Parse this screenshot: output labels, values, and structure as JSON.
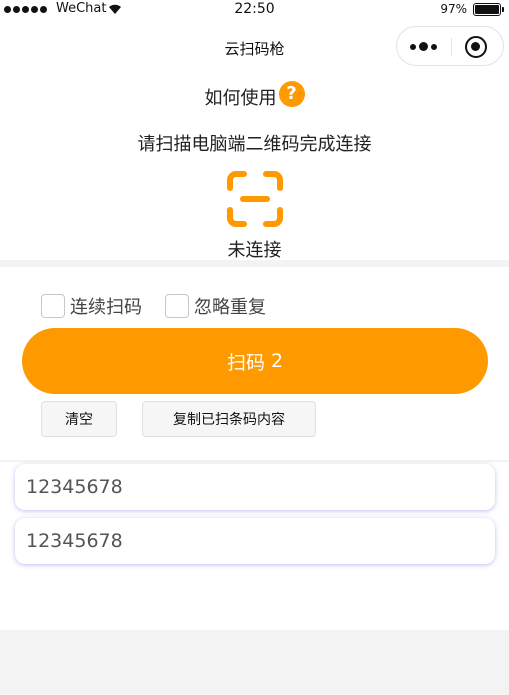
{
  "status_bar": {
    "carrier": "WeChat",
    "time": "22:50",
    "battery": "97%"
  },
  "nav": {
    "title": "云扫码枪"
  },
  "help": {
    "label": "如何使用",
    "icon_char": "?"
  },
  "instruction": "请扫描电脑端二维码完成连接",
  "connection_status": "未连接",
  "options": {
    "continuous": "连续扫码",
    "ignore_duplicates": "忽略重复"
  },
  "scan_button": {
    "label": "扫码",
    "count": "2"
  },
  "actions": {
    "clear": "清空",
    "copy": "复制已扫条码内容"
  },
  "results": [
    "12345678",
    "12345678"
  ],
  "colors": {
    "accent": "#ff9900"
  }
}
